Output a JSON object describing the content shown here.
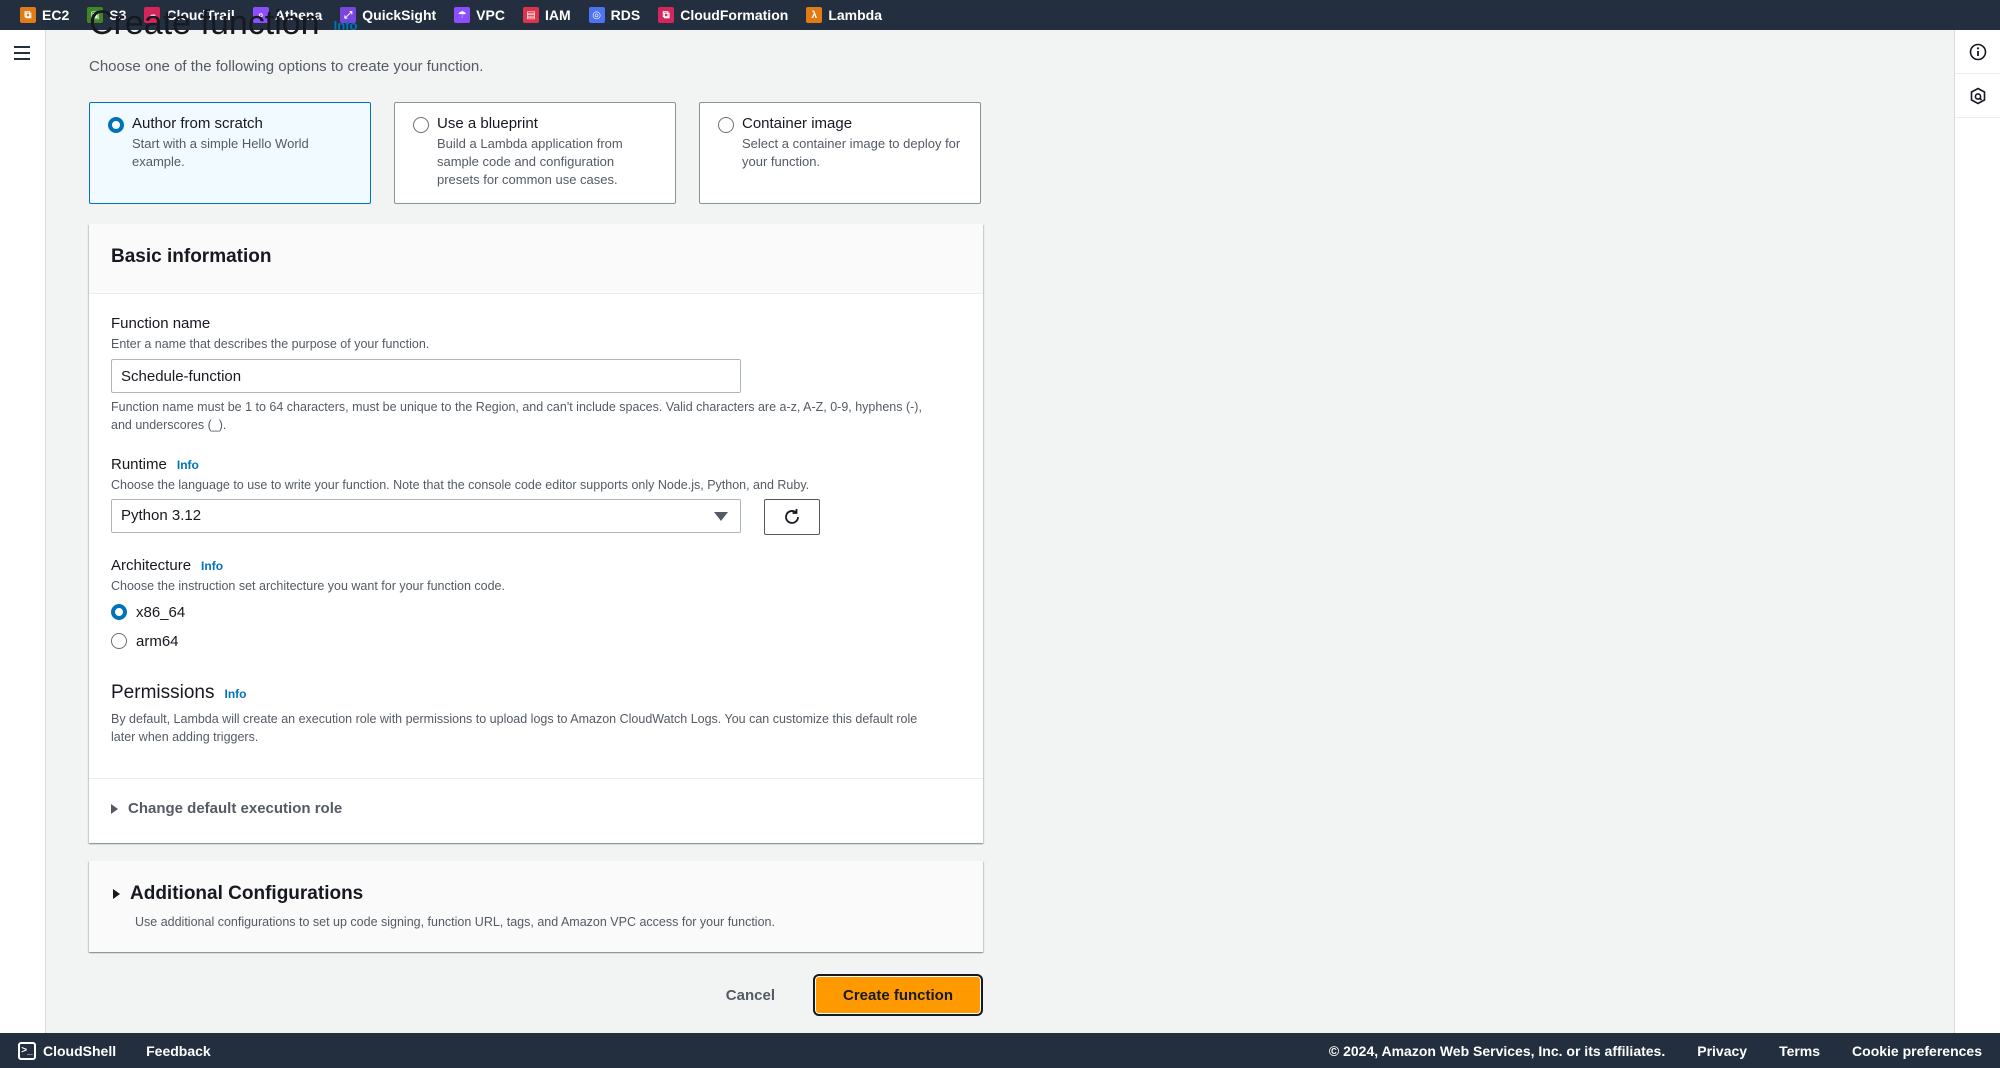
{
  "services_bar": [
    {
      "label": "EC2",
      "icon": "ec2-icon",
      "color": "#e07b16",
      "glyph": "⧉"
    },
    {
      "label": "S3",
      "icon": "s3-icon",
      "color": "#3f8624",
      "glyph": "▣"
    },
    {
      "label": "CloudTrail",
      "icon": "cloudtrail-icon",
      "color": "#d6245c",
      "glyph": "☁"
    },
    {
      "label": "Athena",
      "icon": "athena-icon",
      "color": "#8c4fff",
      "glyph": "⌕"
    },
    {
      "label": "QuickSight",
      "icon": "quicksight-icon",
      "color": "#7b45e0",
      "glyph": "⤢"
    },
    {
      "label": "VPC",
      "icon": "vpc-icon",
      "color": "#8c4fff",
      "glyph": "☂"
    },
    {
      "label": "IAM",
      "icon": "iam-icon",
      "color": "#dd344c",
      "glyph": "▤"
    },
    {
      "label": "RDS",
      "icon": "rds-icon",
      "color": "#4d72f3",
      "glyph": "◎"
    },
    {
      "label": "CloudFormation",
      "icon": "cloudformation-icon",
      "color": "#d6245c",
      "glyph": "⧉"
    },
    {
      "label": "Lambda",
      "icon": "lambda-icon",
      "color": "#e07b16",
      "glyph": "λ"
    }
  ],
  "page": {
    "title": "Create function",
    "info": "Info",
    "subtitle": "Choose one of the following options to create your function."
  },
  "options": [
    {
      "title": "Author from scratch",
      "desc": "Start with a simple Hello World example.",
      "selected": true
    },
    {
      "title": "Use a blueprint",
      "desc": "Build a Lambda application from sample code and configuration presets for common use cases.",
      "selected": false
    },
    {
      "title": "Container image",
      "desc": "Select a container image to deploy for your function.",
      "selected": false
    }
  ],
  "basic_info": {
    "heading": "Basic information",
    "function_name": {
      "label": "Function name",
      "desc": "Enter a name that describes the purpose of your function.",
      "value": "Schedule-function",
      "constraint": "Function name must be 1 to 64 characters, must be unique to the Region, and can't include spaces. Valid characters are a-z, A-Z, 0-9, hyphens (-), and underscores (_)."
    },
    "runtime": {
      "label": "Runtime",
      "info": "Info",
      "desc": "Choose the language to use to write your function. Note that the console code editor supports only Node.js, Python, and Ruby.",
      "value": "Python 3.12"
    },
    "architecture": {
      "label": "Architecture",
      "info": "Info",
      "desc": "Choose the instruction set architecture you want for your function code.",
      "options": [
        {
          "label": "x86_64",
          "selected": true
        },
        {
          "label": "arm64",
          "selected": false
        }
      ]
    },
    "permissions": {
      "label": "Permissions",
      "info": "Info",
      "desc": "By default, Lambda will create an execution role with permissions to upload logs to Amazon CloudWatch Logs. You can customize this default role later when adding triggers."
    },
    "change_role": "Change default execution role"
  },
  "additional": {
    "heading": "Additional Configurations",
    "desc": "Use additional configurations to set up code signing, function URL, tags, and Amazon VPC access for your function."
  },
  "actions": {
    "cancel": "Cancel",
    "create": "Create function"
  },
  "footer": {
    "cloudshell": "CloudShell",
    "feedback": "Feedback",
    "copyright": "© 2024, Amazon Web Services, Inc. or its affiliates.",
    "privacy": "Privacy",
    "terms": "Terms",
    "cookies": "Cookie preferences"
  }
}
